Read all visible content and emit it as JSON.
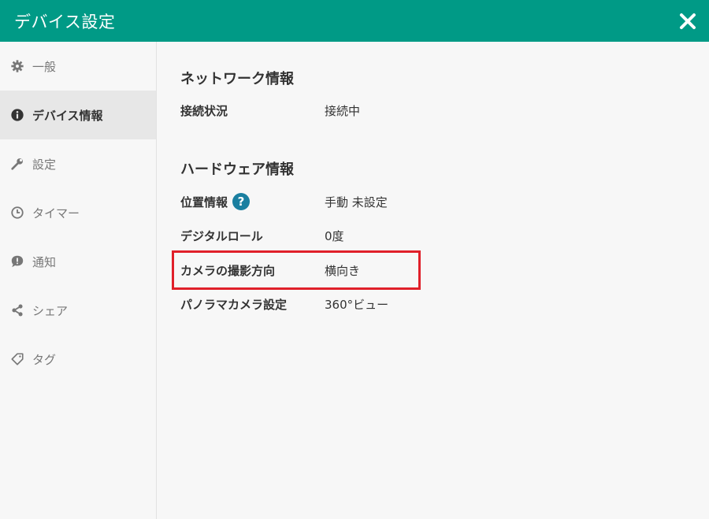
{
  "header": {
    "title": "デバイス設定"
  },
  "sidebar": {
    "items": [
      {
        "label": "一般",
        "icon": "gear-icon"
      },
      {
        "label": "デバイス情報",
        "icon": "info-icon",
        "active": true
      },
      {
        "label": "設定",
        "icon": "wrench-icon"
      },
      {
        "label": "タイマー",
        "icon": "clock-icon"
      },
      {
        "label": "通知",
        "icon": "alert-bubble-icon"
      },
      {
        "label": "シェア",
        "icon": "share-icon"
      },
      {
        "label": "タグ",
        "icon": "tag-icon"
      }
    ]
  },
  "main": {
    "network": {
      "title": "ネットワーク情報",
      "rows": [
        {
          "label": "接続状況",
          "value": "接続中"
        }
      ]
    },
    "hardware": {
      "title": "ハードウェア情報",
      "rows": [
        {
          "label": "位置情報",
          "value": "手動 未設定"
        },
        {
          "label": "デジタルロール",
          "value": "0度"
        },
        {
          "label": "カメラの撮影方向",
          "value": "横向き"
        },
        {
          "label": "パノラマカメラ設定",
          "value": "360°ビュー"
        }
      ]
    }
  },
  "colors": {
    "header": "#009a86",
    "highlight": "#e0202a",
    "help": "#1a7fa0"
  }
}
